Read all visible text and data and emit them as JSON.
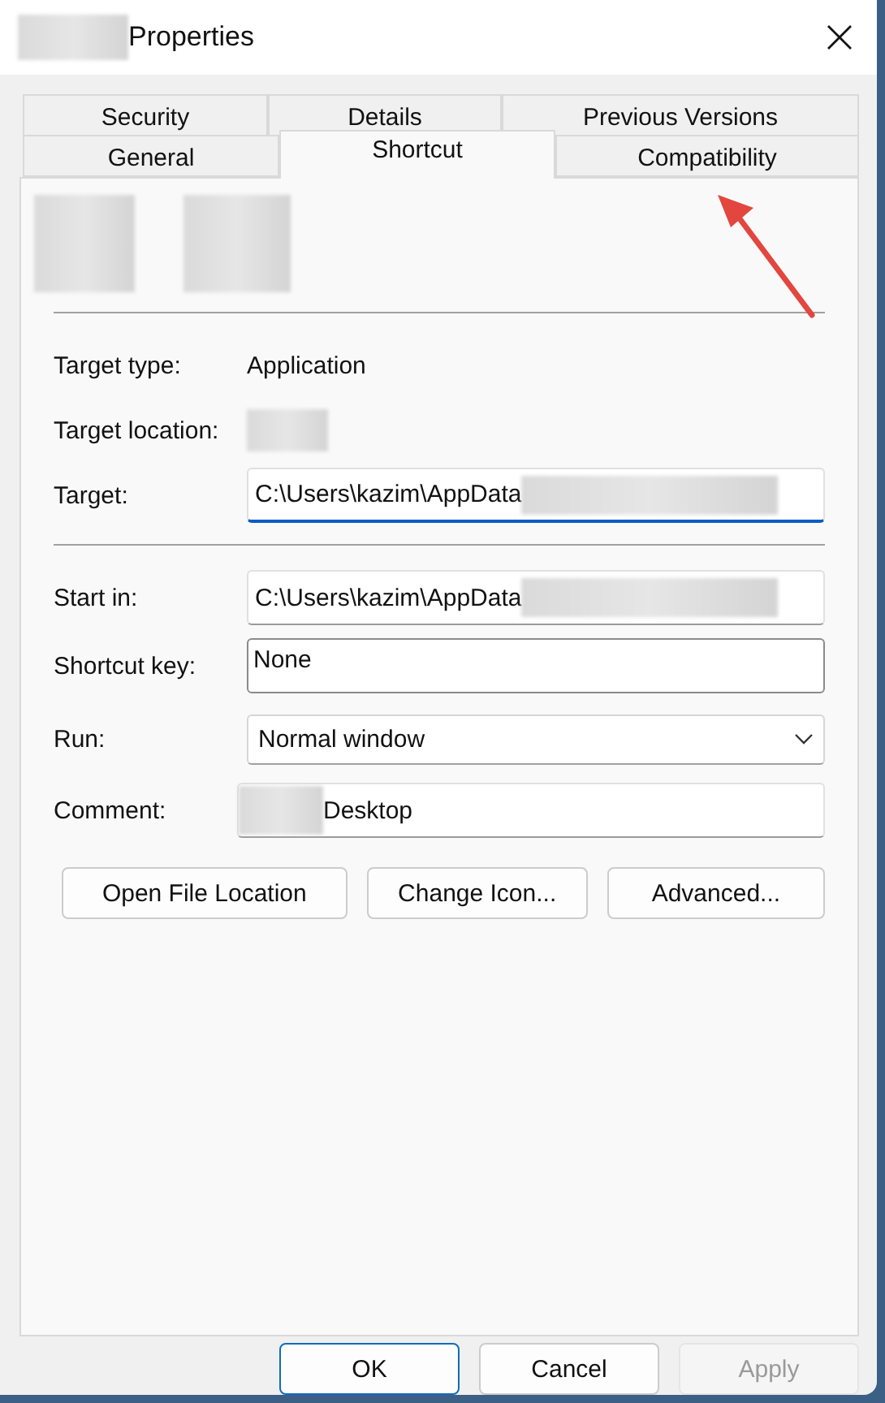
{
  "window": {
    "title": "Properties"
  },
  "tab_rows": [
    [
      {
        "label": "Security",
        "selected": false
      },
      {
        "label": "Details",
        "selected": false
      },
      {
        "label": "Previous Versions",
        "selected": false
      }
    ],
    [
      {
        "label": "General",
        "selected": false
      },
      {
        "label": "Shortcut",
        "selected": true
      },
      {
        "label": "Compatibility",
        "selected": false
      }
    ]
  ],
  "info": [
    {
      "label": "Target type:",
      "value": "Application"
    },
    {
      "label": "Target location:"
    }
  ],
  "fields": [
    {
      "kind": "text",
      "label": "Target:",
      "value": "C:\\Users\\kazim\\AppData",
      "focused": true
    },
    {
      "kind": "divider"
    },
    {
      "kind": "text",
      "label": "Start in:",
      "value": "C:\\Users\\kazim\\AppData",
      "focused": false
    },
    {
      "kind": "hotkey",
      "label": "Shortcut key:",
      "value": "None"
    },
    {
      "kind": "select",
      "label": "Run:",
      "value": "Normal window"
    },
    {
      "kind": "comment",
      "label": "Comment:",
      "value": "Desktop"
    }
  ],
  "actions": [
    "Open File Location",
    "Change Icon...",
    "Advanced..."
  ],
  "annotation": {
    "kind": "arrow"
  },
  "buttons": [
    {
      "label": "OK",
      "default": true,
      "disabled": false
    },
    {
      "label": "Cancel",
      "default": false,
      "disabled": false
    },
    {
      "label": "Apply",
      "default": false,
      "disabled": true
    }
  ]
}
